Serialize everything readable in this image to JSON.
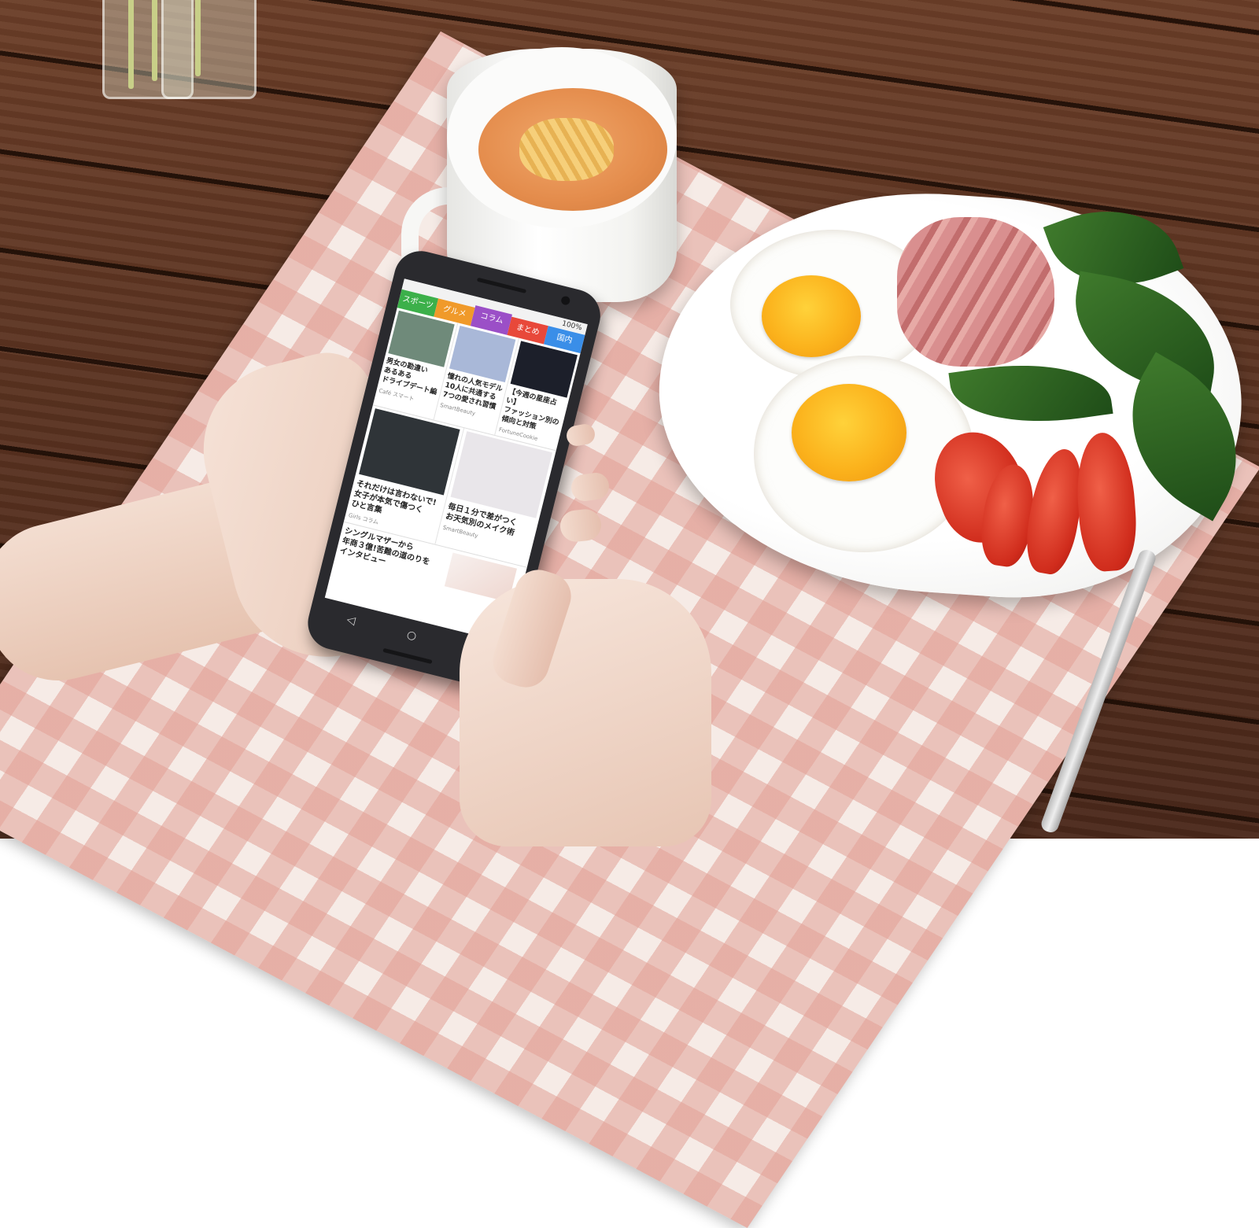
{
  "phone": {
    "status": {
      "battery": "100%"
    },
    "tabs": [
      {
        "label": "スポーツ",
        "color": "#3cb04a"
      },
      {
        "label": "グルメ",
        "color": "#f09a2a"
      },
      {
        "label": "コラム",
        "color": "#9b4fc7",
        "active": true
      },
      {
        "label": "まとめ",
        "color": "#e8483a"
      },
      {
        "label": "国内",
        "color": "#3a8ee8"
      }
    ],
    "articles_row1": [
      {
        "title": "男女の勘違い\nあるある\nドライブデート編",
        "source": "Café スマート",
        "thumb_color": "#6f8a7a"
      },
      {
        "title": "憧れの人気モデル\n10人に共通する\n7つの愛され習慣",
        "source": "SmartBeauty",
        "thumb_color": "#a9b8d8"
      },
      {
        "title": "【今週の星座占い】\nファッション別の\n傾向と対策",
        "source": "FortuneCookie",
        "thumb_color": "#1c1f2a"
      }
    ],
    "articles_row2": [
      {
        "title": "それだけは言わないで!\n女子が本気で傷つく\nひと言集",
        "source": "Girls コラム",
        "thumb_color": "#2f3438"
      },
      {
        "title": "毎日１分で差がつく\nお天気別のメイク術",
        "source": "SmartBeauty",
        "thumb_color": "#e9e6ea"
      }
    ],
    "article_row3": {
      "title": "シングルマザーから\n年商３億!苦難の道のりを\nインタビュー"
    },
    "nav": {
      "back": "◁",
      "home": "○",
      "recent": "□"
    }
  }
}
